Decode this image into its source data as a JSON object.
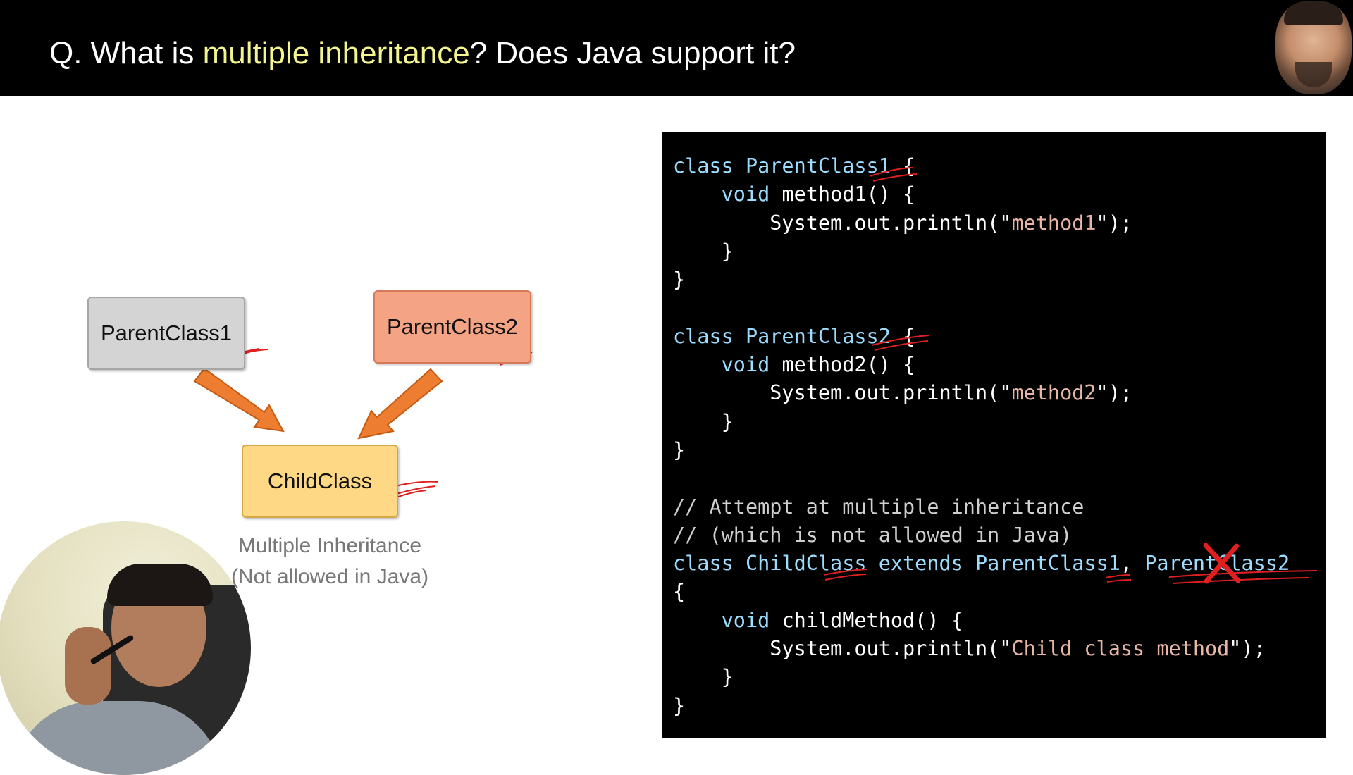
{
  "slide": {
    "title_prefix": "Q. What is ",
    "title_highlight": "multiple inheritance",
    "title_suffix": "? Does Java support it?",
    "highlight_color": "#f5f58f"
  },
  "diagram": {
    "parent1_label": "ParentClass1",
    "parent2_label": "ParentClass2",
    "child_label": "ChildClass",
    "caption_line1": "Multiple Inheritance",
    "caption_line2": "(Not allowed in Java)",
    "arrow_color": "#ed7d31"
  },
  "code": {
    "lines": [
      [
        {
          "t": "class ",
          "c": "kw"
        },
        {
          "t": "ParentClass1",
          "c": "kw"
        },
        {
          "t": " {",
          "c": "pl"
        }
      ],
      [
        {
          "t": "    ",
          "c": "pl"
        },
        {
          "t": "void",
          "c": "kw"
        },
        {
          "t": " method1() {",
          "c": "pl"
        }
      ],
      [
        {
          "t": "        System.out.println(\"",
          "c": "pl"
        },
        {
          "t": "method1",
          "c": "str"
        },
        {
          "t": "\");",
          "c": "pl"
        }
      ],
      [
        {
          "t": "    }",
          "c": "pl"
        }
      ],
      [
        {
          "t": "}",
          "c": "pl"
        }
      ],
      [],
      [
        {
          "t": "class ",
          "c": "kw"
        },
        {
          "t": "ParentClass2",
          "c": "kw"
        },
        {
          "t": " {",
          "c": "pl"
        }
      ],
      [
        {
          "t": "    ",
          "c": "pl"
        },
        {
          "t": "void",
          "c": "kw"
        },
        {
          "t": " method2() {",
          "c": "pl"
        }
      ],
      [
        {
          "t": "        System.out.println(\"",
          "c": "pl"
        },
        {
          "t": "method2",
          "c": "str"
        },
        {
          "t": "\");",
          "c": "pl"
        }
      ],
      [
        {
          "t": "    }",
          "c": "pl"
        }
      ],
      [
        {
          "t": "}",
          "c": "pl"
        }
      ],
      [],
      [
        {
          "t": "// Attempt at multiple inheritance",
          "c": "cmt"
        }
      ],
      [
        {
          "t": "// (which is not allowed in Java)",
          "c": "cmt"
        }
      ],
      [
        {
          "t": "class ",
          "c": "kw"
        },
        {
          "t": "ChildClass",
          "c": "kw"
        },
        {
          "t": " extends ",
          "c": "kw"
        },
        {
          "t": "ParentClass1",
          "c": "kw"
        },
        {
          "t": ", ",
          "c": "pl"
        },
        {
          "t": "ParentClass2",
          "c": "kw"
        }
      ],
      [
        {
          "t": "{",
          "c": "pl"
        }
      ],
      [
        {
          "t": "    ",
          "c": "pl"
        },
        {
          "t": "void",
          "c": "kw"
        },
        {
          "t": " childMethod() {",
          "c": "pl"
        }
      ],
      [
        {
          "t": "        System.out.println(\"",
          "c": "pl"
        },
        {
          "t": "Child class method",
          "c": "str"
        },
        {
          "t": "\");",
          "c": "pl"
        }
      ],
      [
        {
          "t": "    }",
          "c": "pl"
        }
      ],
      [
        {
          "t": "}",
          "c": "pl"
        }
      ]
    ]
  },
  "annotation_color": "#e02020"
}
